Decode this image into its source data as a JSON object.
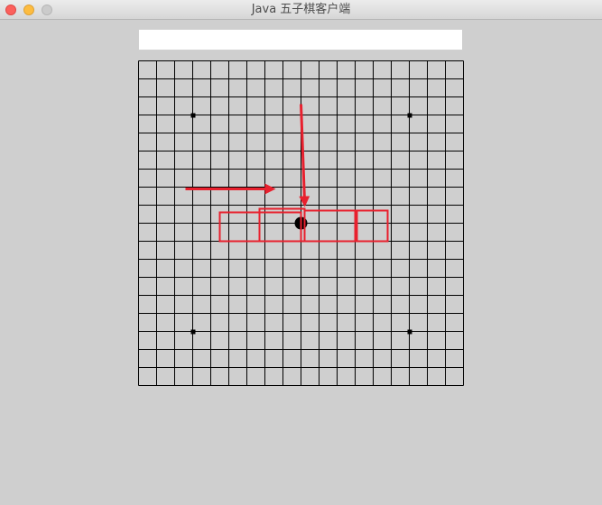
{
  "window": {
    "title": "Java 五子棋客户端",
    "controls": {
      "close": "close-button",
      "minimize": "minimize-button",
      "zoom": "zoom-button"
    }
  },
  "message_field": {
    "value": "",
    "placeholder": ""
  },
  "board": {
    "size": 19,
    "line_color": "#000000",
    "background": "#cfcfcf",
    "star_points": [
      [
        3,
        3
      ],
      [
        15,
        3
      ],
      [
        3,
        15
      ],
      [
        15,
        15
      ]
    ],
    "stones": [
      {
        "col": 9,
        "row": 9,
        "color": "black"
      }
    ]
  },
  "annotations": {
    "color": "#e8202e",
    "arrows": [
      {
        "name": "horizontal-arrow",
        "points": [
          [
            2.6,
            7.1
          ],
          [
            7.3,
            7.1
          ]
        ]
      },
      {
        "name": "vertical-arrow",
        "points": [
          [
            9.0,
            2.4
          ],
          [
            9.2,
            7.8
          ]
        ]
      }
    ],
    "boxes": [
      {
        "name": "highlight-box-1",
        "col": 4.5,
        "row": 8.4,
        "w": 4.5,
        "h": 1.6
      },
      {
        "name": "highlight-box-2",
        "col": 6.7,
        "row": 8.2,
        "w": 2.5,
        "h": 1.8
      },
      {
        "name": "highlight-box-3",
        "col": 9.2,
        "row": 8.3,
        "w": 2.9,
        "h": 1.7
      },
      {
        "name": "highlight-box-4",
        "col": 12.0,
        "row": 8.3,
        "w": 1.8,
        "h": 1.7
      }
    ]
  }
}
